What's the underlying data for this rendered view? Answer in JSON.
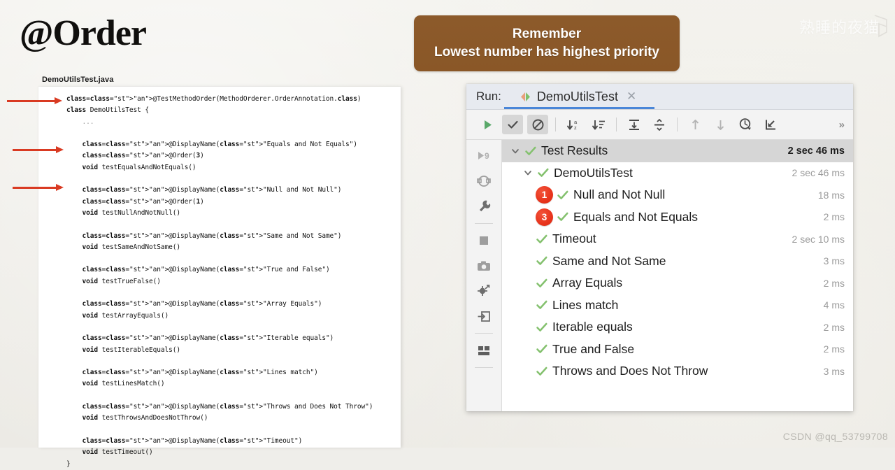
{
  "page": {
    "title": "@Order",
    "watermark_top": "熟睡的夜猫",
    "watermark_bottom": "CSDN @qq_53799708",
    "accent_blue": "#4a86d8",
    "banner_brown": "#8a5727",
    "badge_red": "#e8341c",
    "check_green": "#84c16e"
  },
  "banner": {
    "line1": "Remember",
    "line2": "Lowest number has highest priority"
  },
  "code_card": {
    "filename": "DemoUtilsTest.java",
    "lines": [
      "@TestMethodOrder(MethodOrderer.OrderAnnotation.class)",
      "class DemoUtilsTest {",
      "    ...",
      "",
      "    @DisplayName(\"Equals and Not Equals\")",
      "    @Order(3)",
      "    void testEqualsAndNotEquals()",
      "",
      "    @DisplayName(\"Null and Not Null\")",
      "    @Order(1)",
      "    void testNullAndNotNull()",
      "",
      "    @DisplayName(\"Same and Not Same\")",
      "    void testSameAndNotSame()",
      "",
      "    @DisplayName(\"True and False\")",
      "    void testTrueFalse()",
      "",
      "    @DisplayName(\"Array Equals\")",
      "    void testArrayEquals()",
      "",
      "    @DisplayName(\"Iterable equals\")",
      "    void testIterableEquals()",
      "",
      "    @DisplayName(\"Lines match\")",
      "    void testLinesMatch()",
      "",
      "    @DisplayName(\"Throws and Does Not Throw\")",
      "    void testThrowsAndDoesNotThrow()",
      "",
      "    @DisplayName(\"Timeout\")",
      "    void testTimeout()",
      "}"
    ],
    "annotation_arrows": [
      {
        "target_line": "@TestMethodOrder"
      },
      {
        "target_line": "@Order(3)"
      },
      {
        "target_line": "@Order(1)"
      }
    ]
  },
  "ide": {
    "tabbar": {
      "run_label": "Run:",
      "tab_name": "DemoUtilsTest",
      "tab_icon": "run-config-icon",
      "close_label": "✕"
    },
    "toolbar": {
      "buttons": [
        {
          "name": "rerun-tests-button",
          "icon": "play-icon",
          "active": false
        },
        {
          "name": "show-passed-button",
          "icon": "check-icon",
          "active": true
        },
        {
          "name": "show-ignored-button",
          "icon": "no-entry-icon",
          "active": true
        },
        {
          "name": "sort-alphabetically-button",
          "icon": "sort-alpha-icon",
          "active": false
        },
        {
          "name": "sort-by-duration-button",
          "icon": "sort-duration-icon",
          "active": false
        },
        {
          "name": "expand-all-button",
          "icon": "expand-all-icon",
          "active": false
        },
        {
          "name": "collapse-all-button",
          "icon": "collapse-all-icon",
          "active": false
        },
        {
          "name": "previous-failed-button",
          "icon": "arrow-up-icon",
          "active": false
        },
        {
          "name": "next-failed-button",
          "icon": "arrow-down-icon",
          "active": false
        },
        {
          "name": "test-history-button",
          "icon": "clock-icon",
          "active": false
        },
        {
          "name": "scroll-to-source-button",
          "icon": "scroll-to-source-icon",
          "active": false
        }
      ],
      "overflow_label": "»"
    },
    "gutter": {
      "icons": [
        "rerun-with-debugger-icon",
        "rerun-automatically-icon",
        "settings-wrench-icon",
        "stop-icon",
        "screenshot-icon",
        "thread-dump-icon",
        "export-icon",
        "layout-icon"
      ]
    },
    "tree": {
      "rows": [
        {
          "name": "Test Results",
          "time": "2 sec 46 ms",
          "indent": 0,
          "twisty": true,
          "status": "passed",
          "badge": null,
          "header": true
        },
        {
          "name": "DemoUtilsTest",
          "time": "2 sec 46 ms",
          "indent": 1,
          "twisty": true,
          "status": "passed",
          "badge": null,
          "header": false
        },
        {
          "name": "Null and Not Null",
          "time": "18 ms",
          "indent": 2,
          "twisty": false,
          "status": "passed",
          "badge": "1",
          "header": false
        },
        {
          "name": "Equals and Not Equals",
          "time": "2 ms",
          "indent": 2,
          "twisty": false,
          "status": "passed",
          "badge": "3",
          "header": false
        },
        {
          "name": "Timeout",
          "time": "2 sec 10 ms",
          "indent": 2,
          "twisty": false,
          "status": "passed",
          "badge": null,
          "header": false
        },
        {
          "name": "Same and Not Same",
          "time": "3 ms",
          "indent": 2,
          "twisty": false,
          "status": "passed",
          "badge": null,
          "header": false
        },
        {
          "name": "Array Equals",
          "time": "2 ms",
          "indent": 2,
          "twisty": false,
          "status": "passed",
          "badge": null,
          "header": false
        },
        {
          "name": "Lines match",
          "time": "4 ms",
          "indent": 2,
          "twisty": false,
          "status": "passed",
          "badge": null,
          "header": false
        },
        {
          "name": "Iterable equals",
          "time": "2 ms",
          "indent": 2,
          "twisty": false,
          "status": "passed",
          "badge": null,
          "header": false
        },
        {
          "name": "True and False",
          "time": "2 ms",
          "indent": 2,
          "twisty": false,
          "status": "passed",
          "badge": null,
          "header": false
        },
        {
          "name": "Throws and Does Not Throw",
          "time": "3 ms",
          "indent": 2,
          "twisty": false,
          "status": "passed",
          "badge": null,
          "header": false
        }
      ]
    }
  }
}
